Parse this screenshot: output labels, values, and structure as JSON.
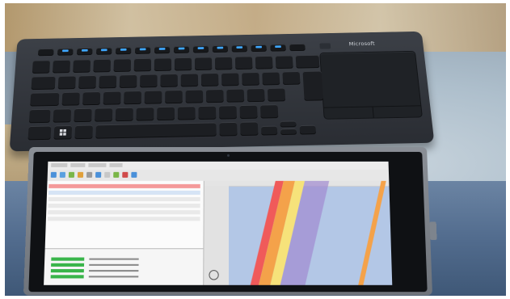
{
  "scene": {
    "keyboard_brand": "Microsoft"
  },
  "colors": {
    "keyboard_body": "#2a2d33",
    "key": "#1c1e22",
    "fn_led": "#3ea7ff",
    "rock": "#c9ad82",
    "denim": "#526c8e",
    "tablet_frame": "#7b8087",
    "screen_bg": "#f3f3f3",
    "map_water": "#b3c7e6",
    "map_red": "#f05a5a",
    "map_orange": "#f4a24a",
    "map_yellow": "#f6e27a",
    "map_purple": "#a18ad0",
    "status_green": "#39b54a"
  },
  "icons": {
    "windows_key": "windows-icon",
    "touchpad": "touchpad",
    "camera": "camera-icon"
  }
}
